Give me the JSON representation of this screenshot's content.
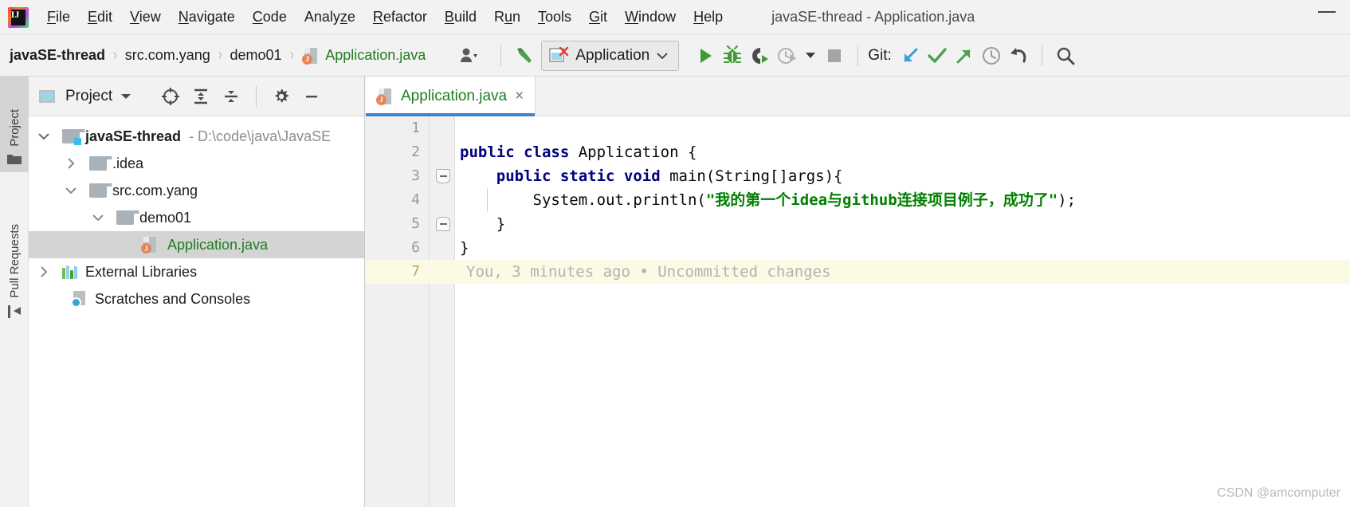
{
  "window": {
    "title": "javaSE-thread - Application.java",
    "minimize_label": "minimize"
  },
  "menubar": {
    "items": [
      {
        "label": "File",
        "mnemonic": "F"
      },
      {
        "label": "Edit",
        "mnemonic": "E"
      },
      {
        "label": "View",
        "mnemonic": "V"
      },
      {
        "label": "Navigate",
        "mnemonic": "N"
      },
      {
        "label": "Code",
        "mnemonic": "C"
      },
      {
        "label": "Analyze",
        "mnemonic": "z"
      },
      {
        "label": "Refactor",
        "mnemonic": "R"
      },
      {
        "label": "Build",
        "mnemonic": "B"
      },
      {
        "label": "Run",
        "mnemonic": "u"
      },
      {
        "label": "Tools",
        "mnemonic": "T"
      },
      {
        "label": "Git",
        "mnemonic": "G"
      },
      {
        "label": "Window",
        "mnemonic": "W"
      },
      {
        "label": "Help",
        "mnemonic": "H"
      }
    ]
  },
  "toolbar": {
    "breadcrumbs": [
      {
        "label": "javaSE-thread",
        "style": "bold"
      },
      {
        "label": "src.com.yang",
        "style": "normal"
      },
      {
        "label": "demo01",
        "style": "normal"
      },
      {
        "label": "Application.java",
        "style": "green-file"
      }
    ],
    "separator": "›",
    "run_config": {
      "label": "Application",
      "icon": "application-config-icon",
      "dropdown": "chevron-down-icon"
    },
    "git_label": "Git:",
    "buttons": [
      {
        "name": "user-avatar-dropdown",
        "icon": "person-icon"
      },
      {
        "name": "build-hammer-button",
        "icon": "hammer-icon"
      },
      {
        "name": "run-button",
        "icon": "play-icon"
      },
      {
        "name": "debug-button",
        "icon": "bug-icon"
      },
      {
        "name": "run-with-coverage-button",
        "icon": "coverage-icon"
      },
      {
        "name": "profile-button",
        "icon": "profiler-icon"
      },
      {
        "name": "profile-dropdown",
        "icon": "chevron-down-icon"
      },
      {
        "name": "stop-button",
        "icon": "stop-square-icon"
      },
      {
        "name": "git-update-button",
        "icon": "arrow-down-left-icon"
      },
      {
        "name": "git-commit-button",
        "icon": "check-icon"
      },
      {
        "name": "git-push-button",
        "icon": "arrow-up-right-icon"
      },
      {
        "name": "git-history-button",
        "icon": "clock-icon"
      },
      {
        "name": "git-rollback-button",
        "icon": "undo-arrow-icon"
      },
      {
        "name": "search-everywhere-button",
        "icon": "search-icon"
      }
    ],
    "colors": {
      "run_green": "#3f9c35",
      "git_update_blue": "#389fd6",
      "git_commit_green": "#49a34a",
      "git_push_green": "#49a34a",
      "stop_gray": "#a5a5a5",
      "clock_gray": "#9a9a9a"
    }
  },
  "stripe": {
    "buttons": [
      {
        "label": "Project",
        "icon": "folder-icon",
        "active": true
      },
      {
        "label": "Pull Requests",
        "icon": "pull-request-icon",
        "active": false
      }
    ]
  },
  "project_panel": {
    "title": "Project",
    "title_icon": "project-view-icon",
    "header_buttons": [
      {
        "name": "select-opened-file-button",
        "icon": "crosshair-target-icon"
      },
      {
        "name": "expand-all-button",
        "icon": "expand-all-icon"
      },
      {
        "name": "collapse-all-button",
        "icon": "collapse-all-icon"
      },
      {
        "name": "settings-button",
        "icon": "gear-icon"
      },
      {
        "name": "hide-panel-button",
        "icon": "minus-icon"
      }
    ],
    "tree": [
      {
        "label": "javaSE-thread",
        "path_suffix": "- D:\\code\\java\\JavaSE",
        "icon": "module-folder-icon",
        "twisty": "expanded",
        "indent": 0,
        "bold": true,
        "selected": false
      },
      {
        "label": ".idea",
        "path_suffix": "",
        "icon": "folder-icon",
        "twisty": "collapsed",
        "indent": 1,
        "bold": false,
        "selected": false
      },
      {
        "label": "src.com.yang",
        "path_suffix": "",
        "icon": "folder-icon",
        "twisty": "expanded",
        "indent": 1,
        "bold": false,
        "selected": false
      },
      {
        "label": "demo01",
        "path_suffix": "",
        "icon": "folder-icon",
        "twisty": "expanded",
        "indent": 2,
        "bold": false,
        "selected": false
      },
      {
        "label": "Application.java",
        "path_suffix": "",
        "icon": "java-file-icon",
        "twisty": "none",
        "indent": 3,
        "bold": false,
        "selected": true
      },
      {
        "label": "External Libraries",
        "path_suffix": "",
        "icon": "external-libraries-icon",
        "twisty": "collapsed",
        "indent": 0,
        "bold": false,
        "selected": false
      },
      {
        "label": "Scratches and Consoles",
        "path_suffix": "",
        "icon": "scratches-icon",
        "twisty": "none",
        "indent": 0,
        "bold": false,
        "selected": false
      }
    ]
  },
  "editor": {
    "tab": {
      "label": "Application.java",
      "icon": "java-file-icon",
      "close_glyph": "×"
    },
    "lines": [
      {
        "num": "1",
        "segments": [],
        "fold": "none",
        "blame": false
      },
      {
        "num": "2",
        "segments": [
          {
            "t": "public ",
            "c": "kw"
          },
          {
            "t": "class ",
            "c": "kw"
          },
          {
            "t": "Application {",
            "c": "plain"
          }
        ],
        "fold": "none",
        "blame": false
      },
      {
        "num": "3",
        "segments": [
          {
            "t": "    ",
            "c": "plain"
          },
          {
            "t": "public ",
            "c": "kw"
          },
          {
            "t": "static ",
            "c": "kw"
          },
          {
            "t": "void ",
            "c": "kw"
          },
          {
            "t": "main(String[]args){",
            "c": "plain"
          }
        ],
        "fold": "top",
        "blame": false
      },
      {
        "num": "4",
        "segments": [
          {
            "t": "        System.out.println(",
            "c": "plain"
          },
          {
            "t": "\"我的第一个idea与github连接项目例子，成功了\"",
            "c": "str"
          },
          {
            "t": ");",
            "c": "plain"
          }
        ],
        "fold": "none",
        "blame": false
      },
      {
        "num": "5",
        "segments": [
          {
            "t": "    }",
            "c": "plain"
          }
        ],
        "fold": "bot",
        "blame": false
      },
      {
        "num": "6",
        "segments": [
          {
            "t": "}",
            "c": "plain"
          }
        ],
        "fold": "none",
        "blame": false
      },
      {
        "num": "7",
        "segments": [
          {
            "t": "You, 3 minutes ago • Uncommitted changes",
            "c": "plain"
          }
        ],
        "fold": "none",
        "blame": true
      }
    ],
    "colors": {
      "keyword": "#000080",
      "string": "#008000",
      "plain": "#080808",
      "blame_bg": "#fcf9e4",
      "blame_text": "#b2b2b2",
      "tab_underline": "#4083c9"
    }
  },
  "watermark": "CSDN @amcomputer"
}
